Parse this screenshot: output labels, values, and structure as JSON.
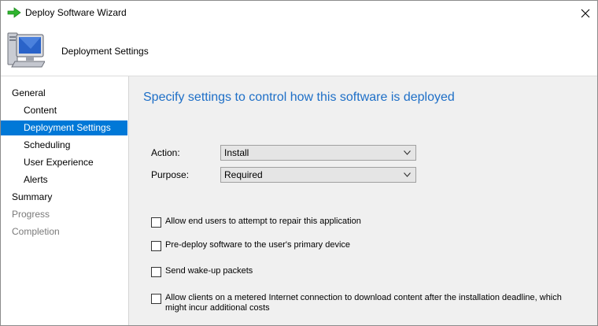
{
  "window": {
    "title": "Deploy Software Wizard"
  },
  "header": {
    "title": "Deployment Settings"
  },
  "sidebar": {
    "items": [
      {
        "label": "General"
      },
      {
        "label": "Content"
      },
      {
        "label": "Deployment Settings"
      },
      {
        "label": "Scheduling"
      },
      {
        "label": "User Experience"
      },
      {
        "label": "Alerts"
      },
      {
        "label": "Summary"
      },
      {
        "label": "Progress"
      },
      {
        "label": "Completion"
      }
    ]
  },
  "main": {
    "heading": "Specify settings to control how this software is deployed",
    "action": {
      "label": "Action:",
      "value": "Install"
    },
    "purpose": {
      "label": "Purpose:",
      "value": "Required"
    },
    "checkboxes": [
      {
        "label": "Allow end users to attempt to repair this application",
        "checked": false
      },
      {
        "label": "Pre-deploy software to the user's primary device",
        "checked": false
      },
      {
        "label": "Send wake-up packets",
        "checked": false
      },
      {
        "label": "Allow clients on a metered Internet connection to download content after the installation deadline, which might incur additional costs",
        "checked": false
      }
    ]
  },
  "colors": {
    "accent": "#0078d7",
    "heading": "#1e6fc7",
    "content_bg": "#f0f0f0",
    "disabled_text": "#7a7a7a"
  }
}
